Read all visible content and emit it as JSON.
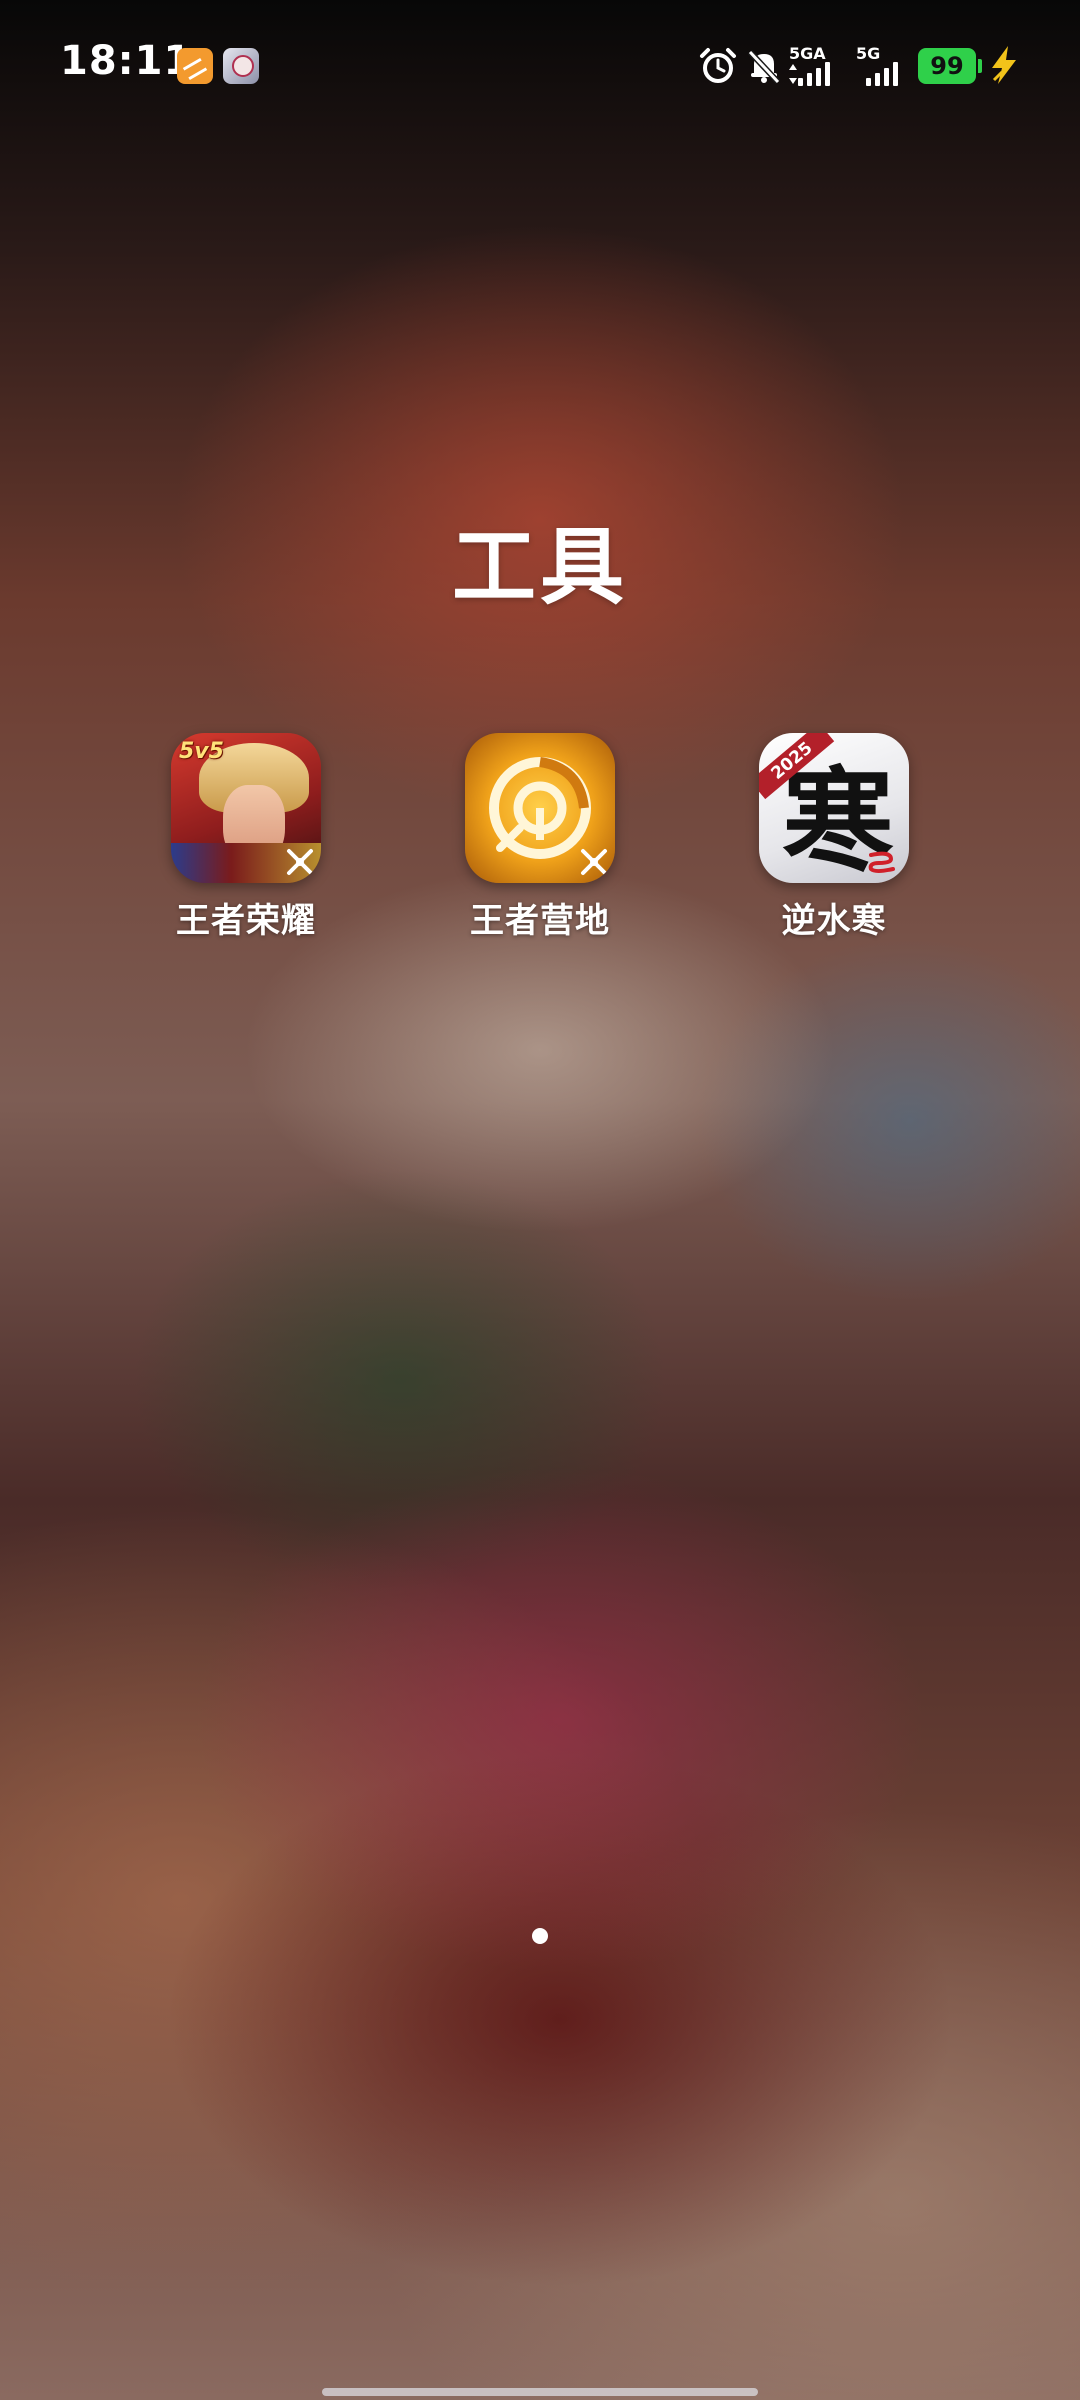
{
  "status_bar": {
    "time": "18:11",
    "notification_icons": [
      "notes-app-icon",
      "anime-app-icon"
    ],
    "network_1_label": "5GA",
    "network_2_label": "5G",
    "battery_level": "99",
    "battery_color": "#2fd04a",
    "charging": true,
    "alarm_set": true,
    "silent_mode": true
  },
  "folder": {
    "title": "工具",
    "apps": [
      {
        "label": "王者荣耀",
        "icon": "honor-of-kings-icon",
        "badge": "5v5"
      },
      {
        "label": "王者营地",
        "icon": "hok-camp-icon"
      },
      {
        "label": "逆水寒",
        "icon": "nishuihan-icon",
        "ribbon": "2025",
        "glyph": "寒"
      }
    ]
  },
  "pager": {
    "pages": 1,
    "current": 1
  }
}
